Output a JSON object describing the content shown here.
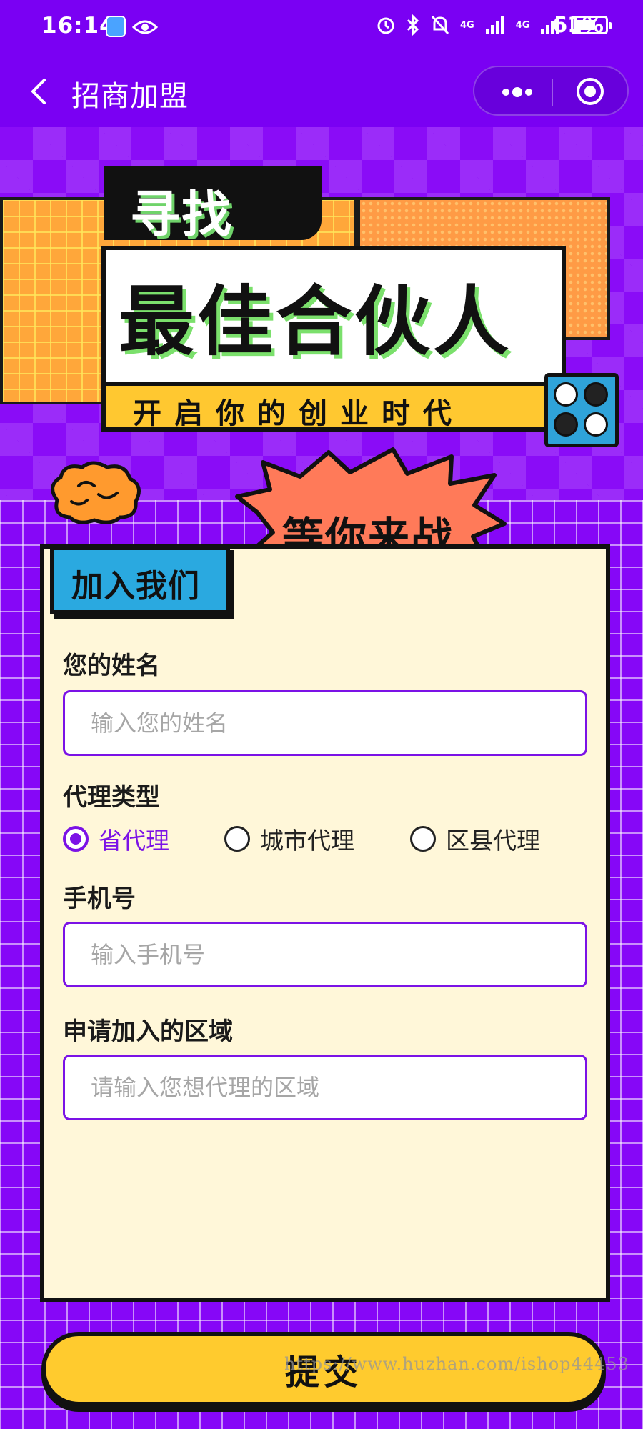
{
  "status_bar": {
    "time": "16:14",
    "battery": "61%",
    "network_1": "4G",
    "network_2": "4G"
  },
  "nav": {
    "title": "招商加盟"
  },
  "banner": {
    "tag": "寻找",
    "headline": "最佳合伙人",
    "subline": "开启你的创业时代",
    "burst": "等你来战"
  },
  "form": {
    "badge": "加入我们",
    "name_label": "您的姓名",
    "name_placeholder": "输入您的姓名",
    "type_label": "代理类型",
    "type_options": [
      {
        "label": "省代理",
        "checked": true
      },
      {
        "label": "城市代理",
        "checked": false
      },
      {
        "label": "区县代理",
        "checked": false
      }
    ],
    "phone_label": "手机号",
    "phone_placeholder": "输入手机号",
    "region_label": "申请加入的区域",
    "region_placeholder": "请输入您想代理的区域",
    "submit_label": "提交"
  },
  "watermark": "https://www.huzhan.com/ishop44453",
  "colors": {
    "primary_purple": "#7b12e6",
    "accent_yellow": "#ffcb2e",
    "accent_blue": "#2aa9e0",
    "card_bg": "#fff7d9"
  }
}
